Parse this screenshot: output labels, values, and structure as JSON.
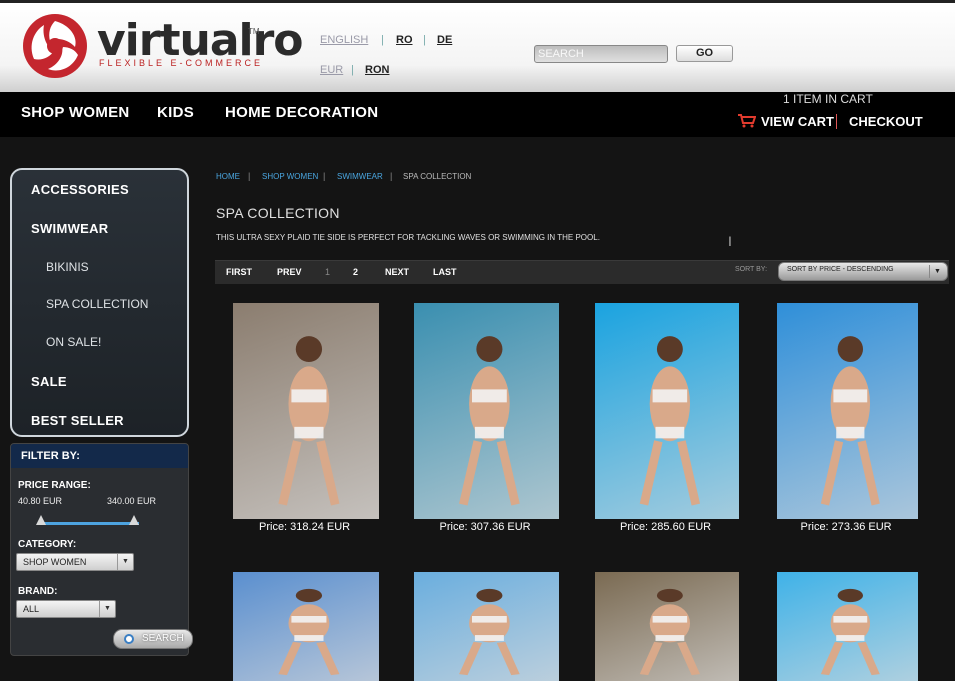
{
  "brand": {
    "name": "virtualro",
    "tm": "TM",
    "tagline": "FLEXIBLE E-COMMERCE"
  },
  "languages": [
    {
      "label": "ENGLISH",
      "active": false
    },
    {
      "label": "RO",
      "active": true
    },
    {
      "label": "DE",
      "active": true
    }
  ],
  "currencies": [
    {
      "label": "EUR",
      "active": false
    },
    {
      "label": "RON",
      "active": true
    }
  ],
  "search": {
    "placeholder": "SEARCH",
    "button": "GO"
  },
  "nav": {
    "items": [
      "SHOP WOMEN",
      "KIDS",
      "HOME DECORATION"
    ],
    "cart_count": "1 ITEM IN CART",
    "view_cart": "VIEW CART",
    "checkout": "CHECKOUT"
  },
  "sidebar": {
    "menu": [
      {
        "label": "ACCESSORIES",
        "level": 1
      },
      {
        "label": "SWIMWEAR",
        "level": 1
      },
      {
        "label": "BIKINIS",
        "level": 2
      },
      {
        "label": "SPA COLLECTION",
        "level": 2
      },
      {
        "label": "ON SALE!",
        "level": 2
      },
      {
        "label": "SALE",
        "level": 1
      },
      {
        "label": "BEST SELLER",
        "level": 1
      }
    ],
    "filter": {
      "title": "FILTER BY:",
      "price_label": "PRICE RANGE:",
      "price_min": "40.80 EUR",
      "price_max": "340.00 EUR",
      "category_label": "CATEGORY:",
      "category_value": "SHOP WOMEN",
      "brand_label": "BRAND:",
      "brand_value": "ALL",
      "search_button": "SEARCH"
    }
  },
  "breadcrumb": [
    "HOME",
    "SHOP WOMEN",
    "SWIMWEAR",
    "SPA COLLECTION"
  ],
  "page": {
    "title": "SPA COLLECTION",
    "description": "THIS ULTRA SEXY PLAID TIE SIDE IS PERFECT FOR TACKLING WAVES OR SWIMMING IN THE POOL."
  },
  "pager": {
    "first": "FIRST",
    "prev": "PREV",
    "page1": "1",
    "page2": "2",
    "next": "NEXT",
    "last": "LAST",
    "sort_label": "SORT BY:",
    "sort_value": "SORT BY PRICE - DESCENDING"
  },
  "products": [
    {
      "price": "Price:  318.24 EUR",
      "bg": "#8b7d6f"
    },
    {
      "price": "Price:  307.36 EUR",
      "bg": "#3a8fb0"
    },
    {
      "price": "Price:  285.60 EUR",
      "bg": "#1aa3e0"
    },
    {
      "price": "Price:  273.36 EUR",
      "bg": "#2f8fd9"
    },
    {
      "price": "",
      "bg": "#5a8fcf"
    },
    {
      "price": "",
      "bg": "#6aaede"
    },
    {
      "price": "",
      "bg": "#7a6a52"
    },
    {
      "price": "",
      "bg": "#3fb2e8"
    }
  ]
}
